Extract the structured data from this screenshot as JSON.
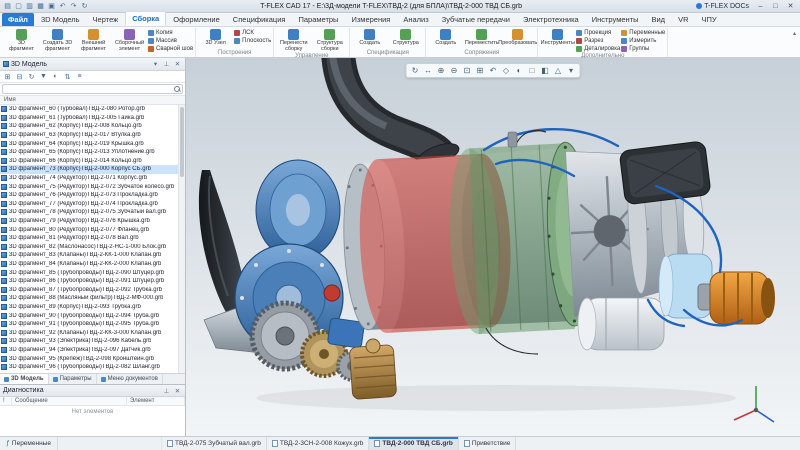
{
  "window": {
    "title": "T-FLEX CAD 17 - Е:\\3Д-модели T-FLEX\\ТВД-2 (для БПЛА)\\ТВД-2-000 ТВД СБ.grb",
    "docs_button": "T-FLEX DOCs",
    "quick_access": [
      {
        "name": "app-menu-icon",
        "glyph": "▤"
      },
      {
        "name": "new-document-icon",
        "glyph": "▢"
      },
      {
        "name": "open-document-icon",
        "glyph": "▥"
      },
      {
        "name": "save-icon",
        "glyph": "▦"
      },
      {
        "name": "print-icon",
        "glyph": "▣"
      },
      {
        "name": "undo-icon",
        "glyph": "↶"
      },
      {
        "name": "redo-icon",
        "glyph": "↷"
      },
      {
        "name": "refresh-icon",
        "glyph": "↻"
      }
    ],
    "controls": [
      {
        "name": "minimize-button",
        "glyph": "–"
      },
      {
        "name": "maximize-button",
        "glyph": "□"
      },
      {
        "name": "close-button",
        "glyph": "✕"
      }
    ]
  },
  "ribbon": {
    "tabs": [
      {
        "label": "Файл",
        "cls": "file"
      },
      {
        "label": "3D Модель"
      },
      {
        "label": "Чертеж"
      },
      {
        "label": "Сборка",
        "cls": "active"
      },
      {
        "label": "Оформление"
      },
      {
        "label": "Спецификация"
      },
      {
        "label": "Параметры"
      },
      {
        "label": "Измерения"
      },
      {
        "label": "Анализ"
      },
      {
        "label": "Зубчатые передачи"
      },
      {
        "label": "Электротехника"
      },
      {
        "label": "Инструменты"
      },
      {
        "label": "Вид"
      },
      {
        "label": "VR"
      },
      {
        "label": "ЧПУ"
      }
    ],
    "groups": [
      {
        "caption": "",
        "big": [
          {
            "label": "3D\nфрагмент",
            "color": "#55a055"
          },
          {
            "label": "Создать 3D\nфрагмент",
            "color": "#3f7fc4"
          },
          {
            "label": "Внешний\nфрагмент",
            "color": "#d4912f"
          },
          {
            "label": "Сборочный\nэлемент",
            "color": "#8a62b8"
          }
        ],
        "small": [
          {
            "label": "Копия",
            "color": "#4f86c2"
          },
          {
            "label": "Массив",
            "color": "#4f86c2"
          },
          {
            "label": "Сварной шов",
            "color": "#c2642f"
          }
        ]
      },
      {
        "caption": "Построения",
        "big": [
          {
            "label": "3D Узел",
            "color": "#3f7fc4"
          }
        ],
        "small": [
          {
            "label": "ЛСК",
            "color": "#b04848"
          },
          {
            "label": "Плоскость",
            "color": "#4f86c2"
          }
        ]
      },
      {
        "caption": "Управление",
        "big": [
          {
            "label": "Перенести\nсборку",
            "color": "#3f7fc4"
          },
          {
            "label": "Структура\nсборки",
            "color": "#55a055"
          }
        ],
        "small": []
      },
      {
        "caption": "Спецификация",
        "big": [
          {
            "label": "Создать",
            "color": "#3f7fc4"
          },
          {
            "label": "Структура",
            "color": "#55a055"
          }
        ],
        "small": []
      },
      {
        "caption": "Сопряжения",
        "big": [
          {
            "label": "Создать",
            "color": "#3f7fc4"
          },
          {
            "label": "Переместить",
            "color": "#55a055"
          },
          {
            "label": "Преобразовать",
            "color": "#d4912f"
          }
        ],
        "small": []
      },
      {
        "caption": "Дополнительно",
        "big": [
          {
            "label": "Инструменты",
            "color": "#3f7fc4"
          }
        ],
        "small": [
          {
            "label": "Проекция",
            "color": "#4f86c2"
          },
          {
            "label": "Разрез",
            "color": "#b04848"
          },
          {
            "label": "Деталировка",
            "color": "#55a055"
          }
        ],
        "small2": [
          {
            "label": "Переменные",
            "color": "#d4912f"
          },
          {
            "label": "Измерить",
            "color": "#4f86c2"
          },
          {
            "label": "Группы",
            "color": "#8a62b8"
          }
        ]
      }
    ]
  },
  "sidebar": {
    "title": "3D Модель",
    "header_icons": [
      {
        "name": "chevron-down-icon",
        "glyph": "▾"
      },
      {
        "name": "pin-icon",
        "glyph": "⊥"
      },
      {
        "name": "close-icon",
        "glyph": "✕"
      }
    ],
    "toolbar_icons": [
      {
        "name": "expand-all-icon",
        "glyph": "⊞"
      },
      {
        "name": "collapse-all-icon",
        "glyph": "⊟"
      },
      {
        "name": "refresh-icon",
        "glyph": "↻"
      },
      {
        "name": "filter-icon",
        "glyph": "▼"
      },
      {
        "name": "show-hidden-icon",
        "glyph": "◐"
      },
      {
        "name": "sort-icon",
        "glyph": "⇅"
      },
      {
        "name": "tree-settings-icon",
        "glyph": "≡"
      }
    ],
    "column_header": "Имя",
    "tree": [
      {
        "label": "3D фрагмент_60 (Турбовал)ТВД-2-080 Ротор.grb"
      },
      {
        "label": "3D фрагмент_61 (Турбовал)ТВД-2-005 Гайка.grb"
      },
      {
        "label": "3D фрагмент_62 (Корпус)ТВД-2-008 Кольцо.grb"
      },
      {
        "label": "3D фрагмент_63 (Корпус)ТВД-2-017 Втулка.grb"
      },
      {
        "label": "3D фрагмент_64 (Корпус)ТВД-2-019 Крышка.grb"
      },
      {
        "label": "3D фрагмент_65 (Корпус)ТВД-2-013 Уплотнение.grb"
      },
      {
        "label": "3D фрагмент_66 (Корпус)ТВД-2-014 Кольцо.grb"
      },
      {
        "label": "3D фрагмент_73 (Корпус)ТВД-2-000 Корпус СБ.grb",
        "cls": "selected"
      },
      {
        "label": "3D фрагмент_74 (Редуктор)ТВД-2-071 Корпус.grb"
      },
      {
        "label": "3D фрагмент_75 (Редуктор)ТВД-2-072 Зубчатое колесо.grb"
      },
      {
        "label": "3D фрагмент_76 (Редуктор)ТВД-2-073 Прокладка.grb"
      },
      {
        "label": "3D фрагмент_77 (Редуктор)ТВД-2-074 Прокладка.grb"
      },
      {
        "label": "3D фрагмент_78 (Редуктор)ТВД-2-075 Зубчатый вал.grb"
      },
      {
        "label": "3D фрагмент_79 (Редуктор)ТВД-2-076 Крышка.grb"
      },
      {
        "label": "3D фрагмент_80 (Редуктор)ТВД-2-077 Фланец.grb"
      },
      {
        "label": "3D фрагмент_81 (Редуктор)ТВД-2-078 Вал.grb"
      },
      {
        "label": "3D фрагмент_82 (Маслонасос)ТВД-2-НС-1-000 Блок.grb"
      },
      {
        "label": "3D фрагмент_83 (Клапаны)ТВД-2-КК-1-000 Клапан.grb"
      },
      {
        "label": "3D фрагмент_84 (Клапаны)ТВД-2-КК-2-000 Клапан.grb"
      },
      {
        "label": "3D фрагмент_85 (Трубопроводы)ТВД-2-090 Штуцер.grb"
      },
      {
        "label": "3D фрагмент_86 (Трубопроводы)ТВД-2-091 Штуцер.grb"
      },
      {
        "label": "3D фрагмент_87 (Трубопроводы)ТВД-2-092 Трубка.grb"
      },
      {
        "label": "3D фрагмент_88 (Масляный фильтр)ТВД-2-МФ-000.grb"
      },
      {
        "label": "3D фрагмент_89 (Корпус)ТВД-2-093 Трубка.grb"
      },
      {
        "label": "3D фрагмент_90 (Трубопроводы)ТВД-2-094 Труба.grb"
      },
      {
        "label": "3D фрагмент_91 (Трубопроводы)ТВД-2-095 Труба.grb"
      },
      {
        "label": "3D фрагмент_92 (Клапаны)ТВД-2-КК-3-000 Клапан.grb"
      },
      {
        "label": "3D фрагмент_93 (Электрика)ТВД-2-096 Кабель.grb"
      },
      {
        "label": "3D фрагмент_94 (Электрика)ТВД-2-097 Датчик.grb"
      },
      {
        "label": "3D фрагмент_95 (Крепёж)ТВД-2-098 Кронштейн.grb"
      },
      {
        "label": "3D фрагмент_96 (Трубопроводы)ТВД-2-082 Шланг.grb"
      }
    ],
    "bottom_tabs": [
      {
        "label": "3D Модель",
        "cls": "active"
      },
      {
        "label": "Параметры"
      },
      {
        "label": "Меню документов"
      }
    ]
  },
  "diagnostics": {
    "title": "Диагностика",
    "columns": {
      "icon": "!",
      "message": "Сообщение",
      "element": "Элемент"
    },
    "empty_text": "Нет элементов"
  },
  "viewport": {
    "toolbar_icons": [
      {
        "name": "rotate-view-icon",
        "glyph": "↻"
      },
      {
        "name": "pan-view-icon",
        "glyph": "↔"
      },
      {
        "name": "zoom-in-icon",
        "glyph": "⊕"
      },
      {
        "name": "zoom-out-icon",
        "glyph": "⊖"
      },
      {
        "name": "zoom-fit-icon",
        "glyph": "⊡"
      },
      {
        "name": "zoom-window-icon",
        "glyph": "⊞"
      },
      {
        "name": "previous-view-icon",
        "glyph": "↶"
      },
      {
        "name": "view-orientation-icon",
        "glyph": "◇"
      },
      {
        "name": "shaded-mode-icon",
        "glyph": "◐"
      },
      {
        "name": "wireframe-mode-icon",
        "glyph": "□"
      },
      {
        "name": "section-view-icon",
        "glyph": "◧"
      },
      {
        "name": "perspective-icon",
        "glyph": "△"
      },
      {
        "name": "more-views-icon",
        "glyph": "▾"
      }
    ],
    "model_colors": {
      "housing_blue": "#4f86c2",
      "combustion_red": "#c8423a",
      "casing_green": "#6f9f6f",
      "metal_gray": "#b9c0c7",
      "accent_orange": "#e0862b",
      "pipe_blue": "#1e63be",
      "carbon_black": "#2e3338",
      "brass": "#b08246"
    },
    "triad_colors": {
      "x": "#c43a34",
      "y": "#3a9e46",
      "z": "#2f62c4"
    }
  },
  "statusbar": {
    "variables_tab": "Переменные",
    "doc_tabs": [
      {
        "label": "ТВД-2-075 Зубчатый вал.grb"
      },
      {
        "label": "ТВД-2-3СН-2-008 Кожух.grb"
      },
      {
        "label": "ТВД-2-000 ТВД СБ.grb",
        "cls": "active"
      },
      {
        "label": "Приветствие"
      }
    ]
  }
}
